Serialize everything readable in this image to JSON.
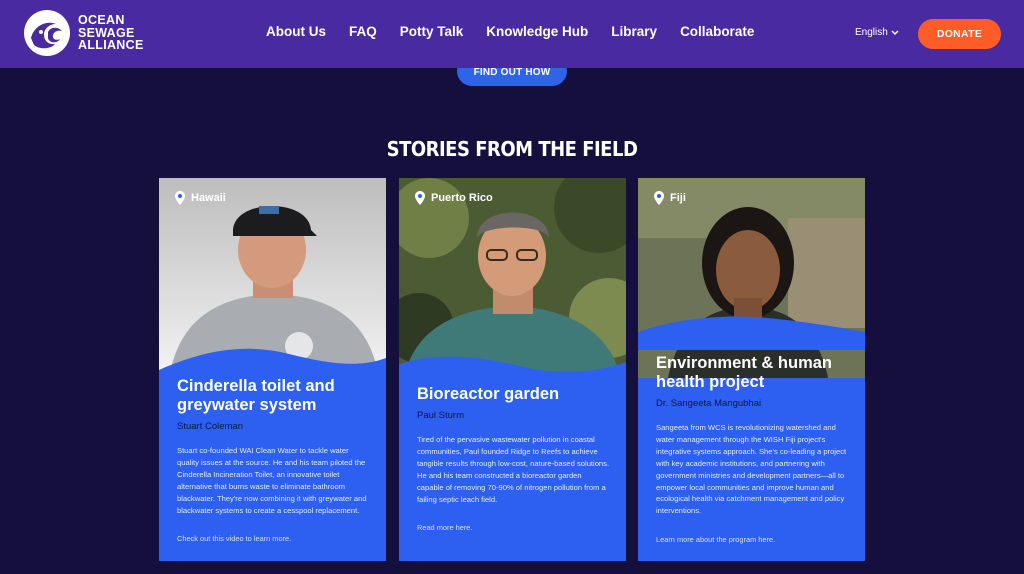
{
  "header": {
    "logo_lines": [
      "OCEAN",
      "SEWAGE",
      "ALLIANCE"
    ],
    "nav": [
      "About Us",
      "FAQ",
      "Potty Talk",
      "Knowledge Hub",
      "Library",
      "Collaborate"
    ],
    "language": "English",
    "donate": "DONATE"
  },
  "find_out_how": "FIND OUT HOW",
  "section_title": "STORIES FROM THE FIELD",
  "colors": {
    "header": "#4a2aa0",
    "page": "#150f3e",
    "card": "#2d5ff0",
    "donate": "#ff5c28"
  },
  "cards": [
    {
      "location": "Hawaii",
      "title": "Cinderella toilet and greywater system",
      "person": "Stuart Coleman",
      "description": "Stuart co-founded WAI Clean Water to tackle water quality issues at the source. He and his team piloted the Cinderella Incineration Toilet, an innovative toilet alternative that burns waste to eliminate bathroom blackwater. They're now combining it with greywater and blackwater systems to create a cesspool replacement.",
      "link": "Check out this video to learn more."
    },
    {
      "location": "Puerto Rico",
      "title": "Bioreactor garden",
      "person": "Paul Sturm",
      "description": "Tired of the pervasive wastewater pollution in coastal communities, Paul founded Ridge to Reefs to achieve tangible results through low-cost, nature-based solutions. He and his team constructed a bioreactor garden capable of removing 70-90% of nitrogen pollution from a failing septic leach field.",
      "link": "Read more here."
    },
    {
      "location": "Fiji",
      "title": "Environment & human health project",
      "person": "Dr. Sangeeta Mangubhai",
      "description": "Sangeeta from WCS is revolutionizing watershed and water management through the WISH Fiji project's integrative systems approach. She's co-leading a project with key academic institutions, and partnering with government ministries and development partners—all to empower local communities and improve human and ecological health via catchment management and policy interventions.",
      "link": "Learn more about the program here."
    }
  ]
}
